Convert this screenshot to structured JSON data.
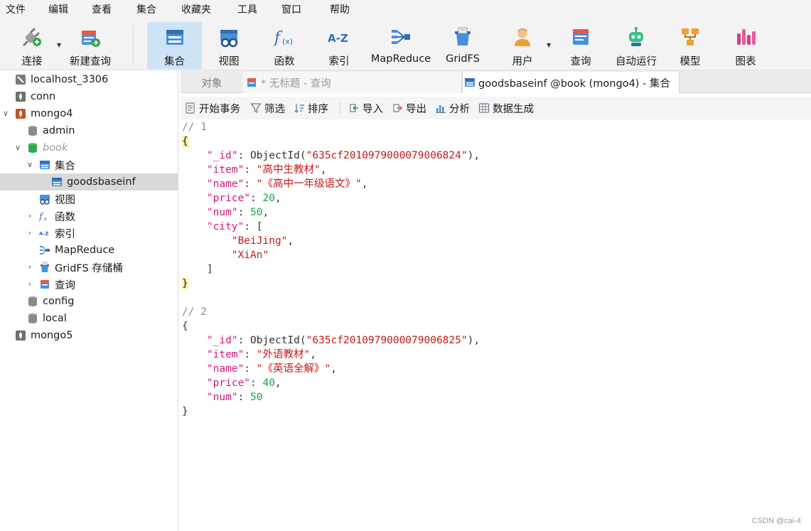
{
  "menubar": {
    "items": [
      "文件",
      "编辑",
      "查看",
      "集合",
      "收藏夹",
      "工具",
      "窗口",
      "帮助"
    ]
  },
  "toolbar": {
    "buttons": [
      {
        "label": "连接",
        "icon": "plug-icon",
        "dropdown": true
      },
      {
        "label": "新建查询",
        "icon": "new-query-icon"
      },
      {
        "label": "集合",
        "icon": "collection-icon",
        "active": true
      },
      {
        "label": "视图",
        "icon": "view-icon"
      },
      {
        "label": "函数",
        "icon": "function-icon"
      },
      {
        "label": "索引",
        "icon": "index-icon"
      },
      {
        "label": "MapReduce",
        "icon": "mapreduce-icon"
      },
      {
        "label": "GridFS",
        "icon": "gridfs-icon"
      },
      {
        "label": "用户",
        "icon": "user-icon",
        "dropdown": true
      },
      {
        "label": "查询",
        "icon": "query-icon"
      },
      {
        "label": "自动运行",
        "icon": "robot-icon"
      },
      {
        "label": "模型",
        "icon": "model-icon"
      },
      {
        "label": "图表",
        "icon": "chart-icon"
      }
    ]
  },
  "sidebar": {
    "items": [
      {
        "label": "localhost_3306",
        "icon": "connection-icon",
        "level": 0
      },
      {
        "label": "conn",
        "icon": "leaf-icon",
        "level": 0
      },
      {
        "label": "mongo4",
        "icon": "leaf-icon",
        "level": 0,
        "expanded": true
      },
      {
        "label": "admin",
        "icon": "database-icon",
        "level": 1
      },
      {
        "label": "book",
        "icon": "database-icon",
        "level": 1,
        "expanded": true
      },
      {
        "label": "集合",
        "icon": "collection-icon",
        "level": 2,
        "expanded": true
      },
      {
        "label": "goodsbaseinf",
        "icon": "table-icon",
        "level": 3,
        "selected": true
      },
      {
        "label": "视图",
        "icon": "view-icon",
        "level": 2
      },
      {
        "label": "函数",
        "icon": "function-icon",
        "level": 2
      },
      {
        "label": "索引",
        "icon": "index-icon",
        "level": 2
      },
      {
        "label": "MapReduce",
        "icon": "mapreduce-icon",
        "level": 2
      },
      {
        "label": "GridFS 存储桶",
        "icon": "gridfs-icon",
        "level": 2
      },
      {
        "label": "查询",
        "icon": "query-icon",
        "level": 2
      },
      {
        "label": "config",
        "icon": "database-icon",
        "level": 1
      },
      {
        "label": "local",
        "icon": "database-icon",
        "level": 1
      },
      {
        "label": "mongo5",
        "icon": "leaf-icon",
        "level": 0
      }
    ]
  },
  "tabs": [
    {
      "label": "对象"
    },
    {
      "label": "* 无标题 - 查询"
    },
    {
      "label": "goodsbaseinf @book (mongo4) - 集合"
    }
  ],
  "subtoolbar": {
    "begin_tx": "开始事务",
    "filter": "筛选",
    "sort": "排序",
    "import": "导入",
    "export": "导出",
    "analyze": "分析",
    "generate": "数据生成"
  },
  "documents": [
    {
      "comment": "// 1",
      "id": "635cf2010979000079006824",
      "item": "高中生教材",
      "name": "《高中一年级语文》",
      "price": "20",
      "num": "50",
      "city": [
        "BeiJing",
        "XiAn"
      ]
    },
    {
      "comment": "// 2",
      "id": "635cf2010979000079006825",
      "item": "外语教材",
      "name": "《英语全解》",
      "price": "40",
      "num": "50"
    }
  ],
  "watermark": "CSDN @cai-4",
  "colors": {
    "key": "#d3187e",
    "string": "#c41a16",
    "number": "#16a34a",
    "comment": "#8c8c8c",
    "active_tool": "#cfe3f7",
    "selected_row": "#d9d9d9"
  }
}
